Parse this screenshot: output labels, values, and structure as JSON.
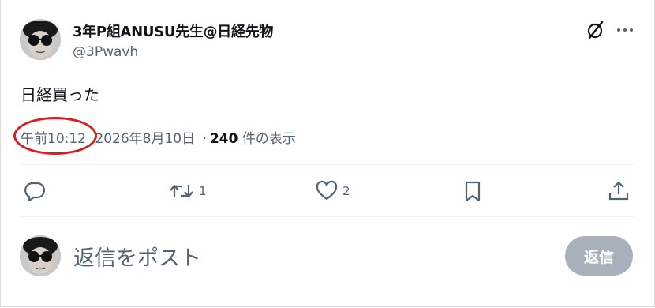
{
  "post": {
    "author_name": "3年P組ANUSU先生@日経先物",
    "author_handle": "@3Pwavh",
    "text": "日経買った",
    "time": "午前10:12",
    "date": "2026年8月10日",
    "separator": "·",
    "views_count": "240",
    "views_label": "件の表示"
  },
  "actions": {
    "reply_count": "",
    "repost_count": "1",
    "like_count": "2"
  },
  "reply_box": {
    "placeholder": "返信をポスト",
    "button_label": "返信"
  },
  "icons": {
    "grok": "grok-icon",
    "more": "more-dots-icon",
    "reply": "comment-icon",
    "repost": "repost-icon",
    "like": "heart-icon",
    "bookmark": "bookmark-icon",
    "share": "share-icon"
  },
  "colors": {
    "annotation_circle": "#d42024",
    "secondary_text": "#536471",
    "reply_button_bg": "#8b98a5"
  }
}
